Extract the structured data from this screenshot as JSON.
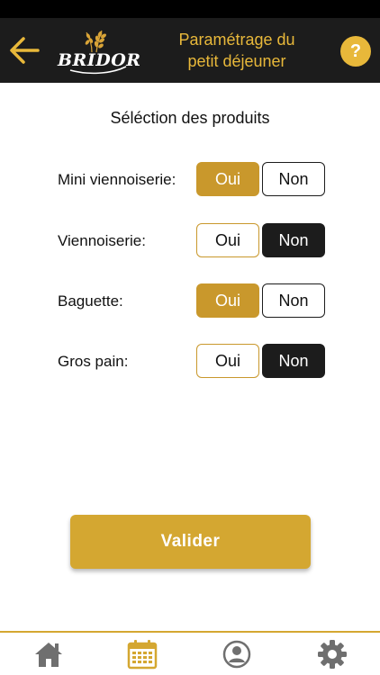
{
  "header": {
    "logo_text": "BRIDOR",
    "title_line1": "Paramétrage du",
    "title_line2": "petit déjeuner",
    "help_label": "?"
  },
  "main": {
    "section_title": "Séléction des produits",
    "products": [
      {
        "label": "Mini viennoiserie:",
        "oui_label": "Oui",
        "non_label": "Non",
        "selected": "oui"
      },
      {
        "label": "Viennoiserie:",
        "oui_label": "Oui",
        "non_label": "Non",
        "selected": "non"
      },
      {
        "label": "Baguette:",
        "oui_label": "Oui",
        "non_label": "Non",
        "selected": "oui"
      },
      {
        "label": "Gros pain:",
        "oui_label": "Oui",
        "non_label": "Non",
        "selected": "non"
      }
    ],
    "validate_label": "Valider"
  },
  "tabbar": {
    "tabs": [
      {
        "icon": "home-icon",
        "active": false
      },
      {
        "icon": "calendar-icon",
        "active": true
      },
      {
        "icon": "profile-icon",
        "active": false
      },
      {
        "icon": "gear-icon",
        "active": false
      }
    ]
  },
  "colors": {
    "accent": "#e8b83a",
    "gold_button": "#d4a731",
    "dark": "#1c1c1c",
    "tab_inactive": "#6f6f6f"
  }
}
